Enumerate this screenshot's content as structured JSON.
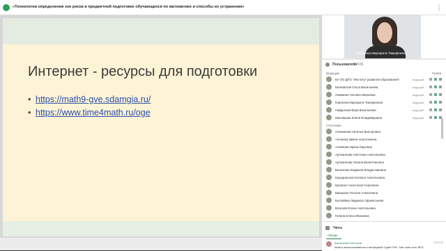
{
  "window": {
    "title": "«Технологии определения зон риска в предметной подготовке обучающихся по математике и способы их устранения»",
    "menu_icon": "more-vertical-icon"
  },
  "slide": {
    "title": "Интернет - ресурсы для подготовки",
    "links": [
      "https://math9-gve.sdamgia.ru/",
      "https://www.time4math.ru/oge"
    ],
    "bullet": "•"
  },
  "video": {
    "caption": "Корнеева Маргарита Тимофеевна"
  },
  "users": {
    "header": "Пользователи",
    "count": "91/106",
    "presenters_label": "Ведущие",
    "rights_label": "Права",
    "participants_label": "Участники",
    "presenters": [
      {
        "name": "БУ ОО ДПО \"Институт развития образования\"",
        "role": "ведущий"
      },
      {
        "name": "Балковская Ольга Васильевна",
        "role": "ведущий"
      },
      {
        "name": "Ломакина Татьяна Ивановна",
        "role": "ведущий"
      },
      {
        "name": "Корнеева Маргарита Тимофеевна",
        "role": "ведущий"
      },
      {
        "name": "Найденова Вера Васильевна",
        "role": "ведущий"
      },
      {
        "name": "Шеховцова Елена Владимировна",
        "role": "ведущий"
      }
    ],
    "participants": [
      "Алимовова Наталья Викторовна",
      "Алешина Ирина Анатольевна",
      "Алиевова Ирина Юрьевна",
      "Артемонова Светлана Анатольевна",
      "Артемонова Оксана Валентиновна",
      "Бегинкова Людмила Владиславовна",
      "Бородинская Наталья Анатольевна",
      "Бугаенко Анастасия Сергеевна",
      "Вакарова Татьяна Алексеевна",
      "Белгайвер Людмила Афанасьевна",
      "Власова Елена Анатольевна",
      "Галина Елена Ивановна"
    ]
  },
  "chat": {
    "title": "Чаты",
    "tab": "Общие",
    "author": "Васильева Светлана",
    "time": "16:40:08",
    "message": "Можно воспользоваться платформой Сдам ГИА. Там тоже есть ВПЗ"
  },
  "colors": {
    "slide_bg": "#fdf3d6",
    "link": "#2a4fa8",
    "accent": "#2e7d4f"
  }
}
